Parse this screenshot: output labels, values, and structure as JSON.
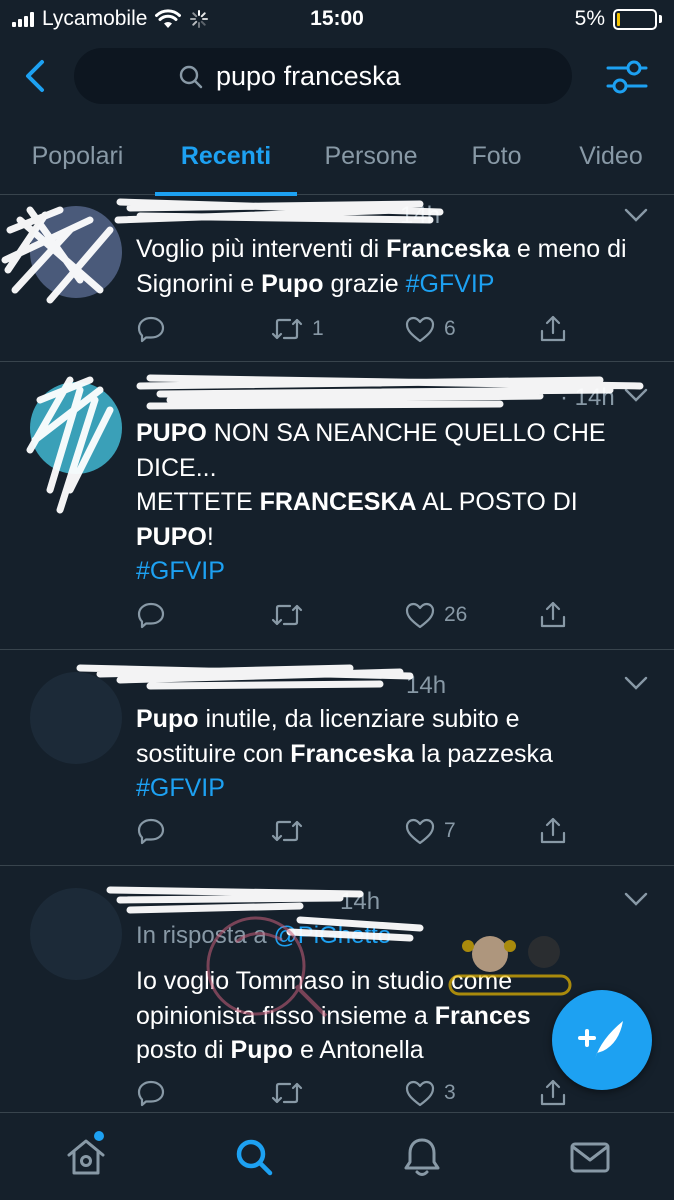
{
  "status_bar": {
    "carrier": "Lycamobile",
    "time": "15:00",
    "battery": "5%"
  },
  "search": {
    "query": "pupo franceska"
  },
  "tabs": [
    {
      "label": "Popolari",
      "active": false
    },
    {
      "label": "Recenti",
      "active": true
    },
    {
      "label": "Persone",
      "active": false
    },
    {
      "label": "Foto",
      "active": false
    },
    {
      "label": "Video",
      "active": false
    }
  ],
  "tweets": [
    {
      "time": "14h",
      "text_parts": [
        {
          "t": "Voglio più interventi di ",
          "style": "normal"
        },
        {
          "t": "Franceska",
          "style": "bold"
        },
        {
          "t": " e meno di Signorini e ",
          "style": "normal"
        },
        {
          "t": "Pupo",
          "style": "bold"
        },
        {
          "t": " grazie ",
          "style": "normal"
        },
        {
          "t": "#GFVIP",
          "style": "hashtag"
        }
      ],
      "retweets": "1",
      "likes": "6"
    },
    {
      "meta": "· 14h",
      "line1": [
        {
          "t": "PUPO",
          "style": "bold"
        },
        {
          "t": " NON SA NEANCHE QUELLO CHE DICE...",
          "style": "normal"
        }
      ],
      "line2": [
        {
          "t": "METTETE ",
          "style": "normal"
        },
        {
          "t": "FRANCESKA",
          "style": "bold"
        },
        {
          "t": " AL POSTO DI ",
          "style": "normal"
        },
        {
          "t": "PUPO",
          "style": "bold"
        },
        {
          "t": "!",
          "style": "normal"
        }
      ],
      "hashtag": "#GFVIP",
      "retweets": "",
      "likes": "26"
    },
    {
      "time": "14h",
      "text_parts": [
        {
          "t": "Pupo",
          "style": "bold"
        },
        {
          "t": " inutile, da licenziare subito e sostituire con ",
          "style": "normal"
        },
        {
          "t": "Franceska",
          "style": "bold"
        },
        {
          "t": " la pazzeska",
          "style": "normal"
        }
      ],
      "hashtag": "#GFVIP",
      "retweets": "",
      "likes": "7"
    },
    {
      "time": "14h",
      "reply_prefix": "In risposta a",
      "reply_handle": "@PiGhetto",
      "text_parts": [
        {
          "t": "Io voglio Tommaso in studio come opinionista fisso insieme a ",
          "style": "normal"
        },
        {
          "t": "Frances",
          "style": "bold"
        },
        {
          "t": " posto di ",
          "style": "normal"
        },
        {
          "t": "Pupo",
          "style": "bold"
        },
        {
          "t": " e Antonella",
          "style": "normal"
        }
      ],
      "retweets": "",
      "likes": "3"
    }
  ],
  "colors": {
    "background": "#15202b",
    "accent": "#1da1f2",
    "secondary_text": "#8899a6",
    "divider": "#38444d"
  },
  "icons": {
    "back": "chevron-left-icon",
    "search": "search-icon",
    "filter": "sliders-icon",
    "reply": "comment-icon",
    "retweet": "retweet-icon",
    "like": "heart-icon",
    "share": "share-icon",
    "compose": "compose-tweet-icon",
    "home": "home-icon",
    "explore": "search-icon",
    "notifications": "bell-icon",
    "messages": "envelope-icon"
  }
}
